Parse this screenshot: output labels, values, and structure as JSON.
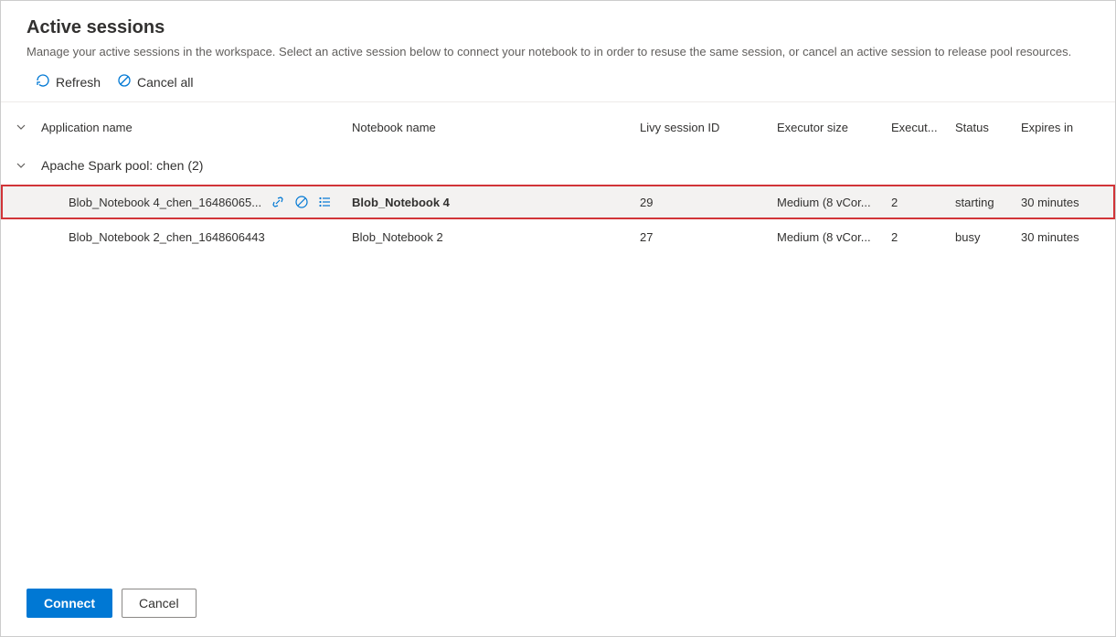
{
  "title": "Active sessions",
  "subtitle": "Manage your active sessions in the workspace. Select an active session below to connect your notebook to in order to resuse the same session, or cancel an active session to release pool resources.",
  "toolbar": {
    "refresh_label": "Refresh",
    "cancel_all_label": "Cancel all"
  },
  "columns": {
    "app_name": "Application name",
    "notebook_name": "Notebook name",
    "livy_id": "Livy session ID",
    "executor_size": "Executor size",
    "executors": "Execut...",
    "status": "Status",
    "expires": "Expires in"
  },
  "group": {
    "label": "Apache Spark pool: chen (2)"
  },
  "rows": [
    {
      "app_name": "Blob_Notebook 4_chen_16486065...",
      "notebook_name": "Blob_Notebook 4",
      "livy_id": "29",
      "executor_size": "Medium (8 vCor...",
      "executors": "2",
      "status": "starting",
      "expires": "30 minutes",
      "selected": true
    },
    {
      "app_name": "Blob_Notebook 2_chen_1648606443",
      "notebook_name": "Blob_Notebook 2",
      "livy_id": "27",
      "executor_size": "Medium (8 vCor...",
      "executors": "2",
      "status": "busy",
      "expires": "30 minutes",
      "selected": false
    }
  ],
  "footer": {
    "connect_label": "Connect",
    "cancel_label": "Cancel"
  }
}
